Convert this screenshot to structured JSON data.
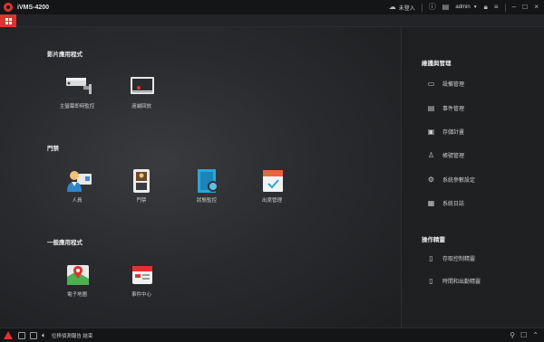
{
  "titlebar": {
    "app_title": "iVMS-4200",
    "cloud_label": "未登入",
    "user_label": "admin"
  },
  "sections": {
    "video": "影片應用程式",
    "access": "門禁",
    "general": "一般應用程式"
  },
  "tiles": {
    "main_view": "主螢幕即時監控",
    "remote_playback": "遠端回放",
    "person": "人員",
    "access_control": "門禁",
    "status_monitor": "狀態監控",
    "attendance": "出席管理",
    "emap": "電子地圖",
    "event_center": "事件中心"
  },
  "right_panel": {
    "maintenance_title": "維護與管理",
    "items": [
      {
        "label": "設備管理",
        "icon": "device-icon"
      },
      {
        "label": "事件管理",
        "icon": "event-icon"
      },
      {
        "label": "存儲計畫",
        "icon": "storage-icon"
      },
      {
        "label": "帳號管理",
        "icon": "account-icon"
      },
      {
        "label": "系統參數設定",
        "icon": "gear-icon"
      },
      {
        "label": "系統日誌",
        "icon": "log-icon"
      }
    ],
    "wizard_title": "操作精靈",
    "wizards": [
      {
        "label": "存取控制精靈",
        "icon": "wizard-icon"
      },
      {
        "label": "時間和出勤精靈",
        "icon": "wizard-icon"
      }
    ]
  },
  "statusbar": {
    "text": "位移偵測報告 結束"
  },
  "colors": {
    "accent": "#e0332f",
    "background": "#1b1c1e"
  }
}
